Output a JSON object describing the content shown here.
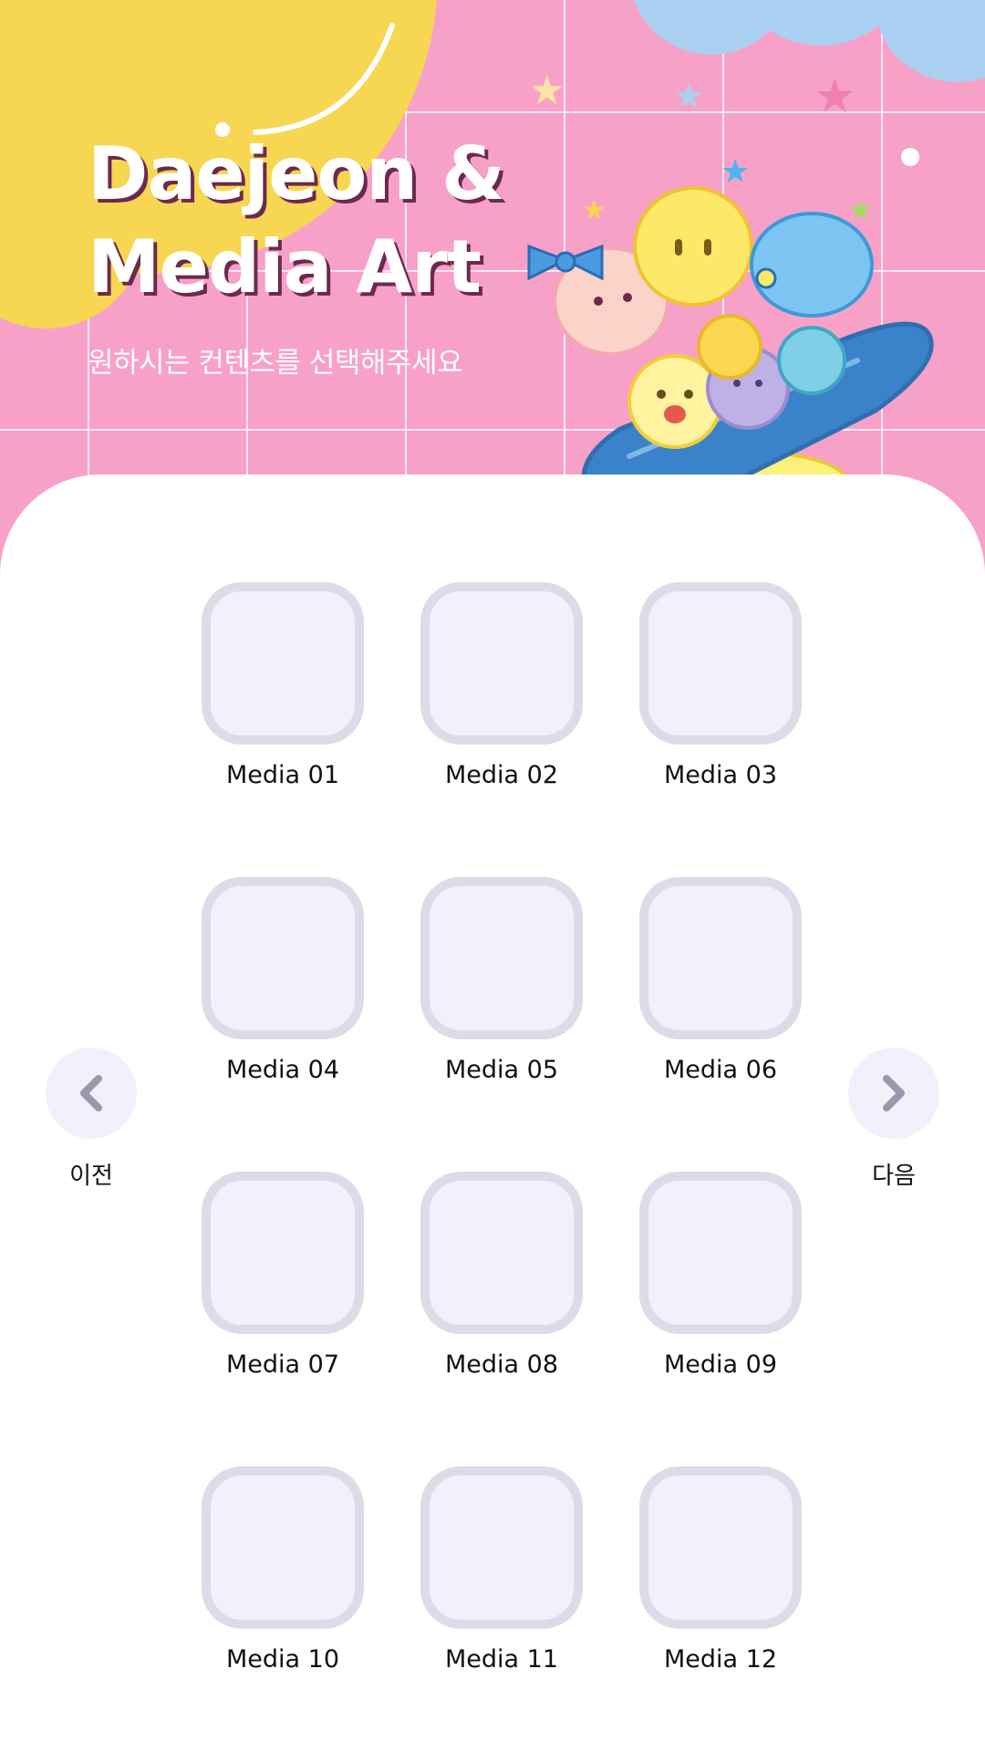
{
  "header": {
    "title_line1": "Daejeon &",
    "title_line2": "Media Art",
    "subtitle": "원하시는 컨텐츠를 선택해주세요"
  },
  "media_items": [
    {
      "label": "Media 01"
    },
    {
      "label": "Media 02"
    },
    {
      "label": "Media 03"
    },
    {
      "label": "Media 04"
    },
    {
      "label": "Media 05"
    },
    {
      "label": "Media 06"
    },
    {
      "label": "Media 07"
    },
    {
      "label": "Media 08"
    },
    {
      "label": "Media 09"
    },
    {
      "label": "Media 10"
    },
    {
      "label": "Media 11"
    },
    {
      "label": "Media 12"
    }
  ],
  "nav": {
    "prev_label": "이전",
    "next_label": "다음",
    "prev_icon": "chevron-left-icon",
    "next_icon": "chevron-right-icon"
  },
  "colors": {
    "header_pink": "#f7a1c8",
    "blob_yellow": "#f7d652",
    "cloud_blue": "#a9d0f1",
    "tile_border": "#dedbe9",
    "tile_fill": "#f2f0fb",
    "chevron": "#9b97ad"
  }
}
